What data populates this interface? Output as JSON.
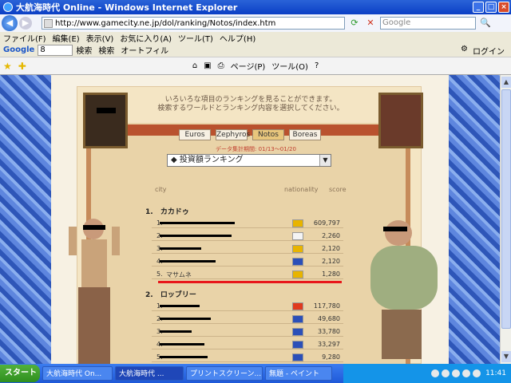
{
  "window": {
    "title": "大航海時代 Online - Windows Internet Explorer",
    "min": "_",
    "max": "□",
    "close": "×"
  },
  "address": {
    "url": "http://www.gamecity.ne.jp/dol/ranking/Notos/index.htm",
    "search_placeholder": "Google"
  },
  "menu": {
    "items": [
      "ファイル(F)",
      "編集(E)",
      "表示(V)",
      "お気に入り(A)",
      "ツール(T)",
      "ヘルプ(H)"
    ]
  },
  "google_toolbar": {
    "logo": "Google",
    "box_value": "8",
    "search_label": "検索",
    "search2_label": "検索",
    "autofill_label": "オートフィル",
    "login_label": "ログイン"
  },
  "fav_toolbar": {
    "page_label": "ページ(P)",
    "tools_label": "ツール(O)"
  },
  "page": {
    "intro_line1": "いろいろな項目のランキングを見ることができます。",
    "intro_line2": "検索するワールドとランキング内容を選択してください。",
    "tabs": [
      {
        "label": "Euros",
        "active": false
      },
      {
        "label": "Zephyros",
        "active": false
      },
      {
        "label": "Notos",
        "active": true
      },
      {
        "label": "Boreas",
        "active": false
      }
    ],
    "period": "データ集計期間: 01/13～01/20",
    "dropdown_value": "◆ 投資額ランキング",
    "columns": {
      "city": "city",
      "nationality": "nationality",
      "score": "score"
    },
    "groups": [
      {
        "rank": "1.",
        "name": "カカドゥ",
        "rows": [
          {
            "rank": "1.",
            "name": "",
            "score": "609,797",
            "flag": "#E8B400"
          },
          {
            "rank": "2.",
            "name": "",
            "score": "2,260",
            "flag": "#F4F4F4"
          },
          {
            "rank": "3.",
            "name": "",
            "score": "2,120",
            "flag": "#E8B400"
          },
          {
            "rank": "4.",
            "name": "",
            "score": "2,120",
            "flag": "#2B4FB8"
          },
          {
            "rank": "5.",
            "name": "マサムネ",
            "score": "1,280",
            "flag": "#E8B400"
          }
        ]
      },
      {
        "rank": "2.",
        "name": "ロッブリー",
        "rows": [
          {
            "rank": "1.",
            "name": "",
            "score": "117,780",
            "flag": "#E03A1E"
          },
          {
            "rank": "2.",
            "name": "",
            "score": "49,680",
            "flag": "#2B4FB8"
          },
          {
            "rank": "3.",
            "name": "",
            "score": "33,780",
            "flag": "#2B4FB8"
          },
          {
            "rank": "4.",
            "name": "",
            "score": "33,297",
            "flag": "#2B4FB8"
          },
          {
            "rank": "5.",
            "name": "",
            "score": "9,280",
            "flag": "#2B4FB8"
          }
        ]
      }
    ]
  },
  "taskbar": {
    "start": "スタート",
    "tasks": [
      {
        "label": "大航海時代 On...",
        "active": false
      },
      {
        "label": "大航海時代 ...",
        "active": true
      },
      {
        "label": "プリントスクリーン...",
        "active": false
      },
      {
        "label": "無題 - ペイント",
        "active": false
      }
    ],
    "clock": "11:41"
  }
}
